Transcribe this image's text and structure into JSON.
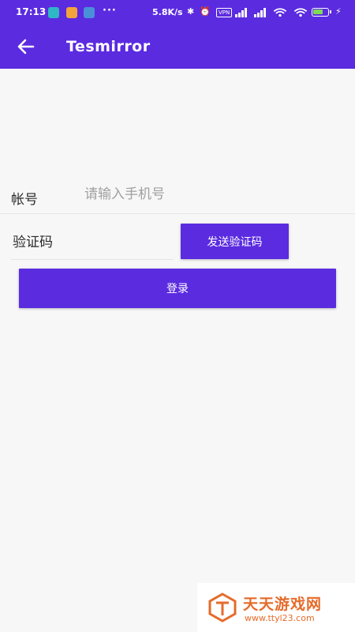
{
  "status_bar": {
    "time": "17:13",
    "dots": "···",
    "speed": "5.8K/s",
    "bluetooth_icon": "bluetooth-icon",
    "alarm_icon": "alarm-icon",
    "vpn": "VPN",
    "charging_icon": "bolt-icon"
  },
  "app_bar": {
    "back_icon": "arrow-left-icon",
    "title": "Tesmirror"
  },
  "form": {
    "account_label": "帐号",
    "account_placeholder": "请输入手机号",
    "code_placeholder": "验证码",
    "send_code_label": "发送验证码",
    "login_label": "登录"
  },
  "watermark": {
    "title": "天天游戏网",
    "url": "www.ttyl23.com"
  },
  "colors": {
    "accent": "#5b2be0",
    "background": "#f7f7f8",
    "watermark": "#e56b2b"
  }
}
